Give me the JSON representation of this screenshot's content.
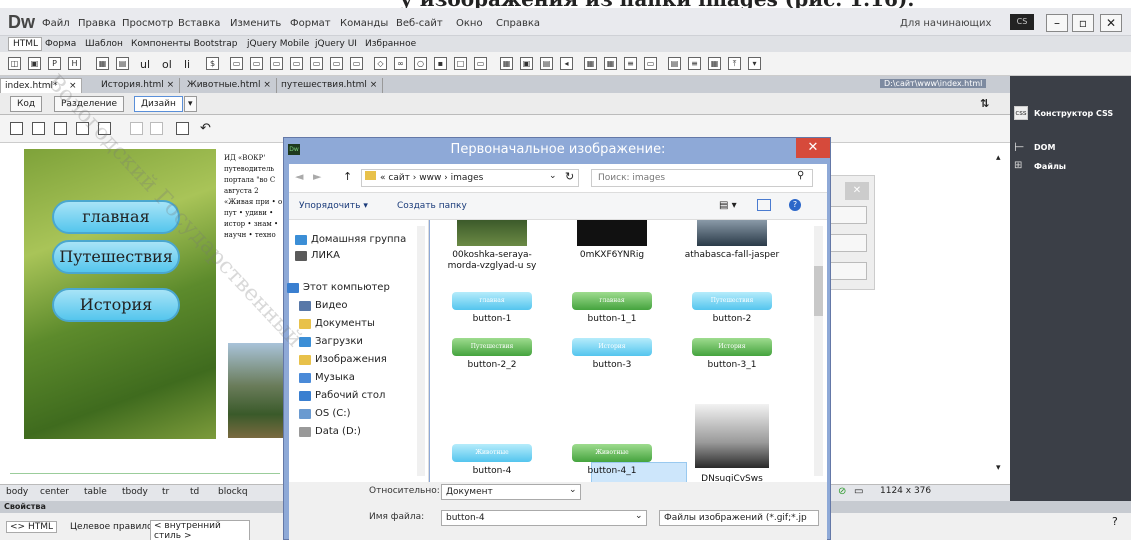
{
  "app": {
    "logo": "Dw",
    "workspace": "Для начинающих",
    "cs_badge": "CS"
  },
  "menu": [
    "Файл",
    "Правка",
    "Просмотр",
    "Вставка",
    "Изменить",
    "Формат",
    "Команды",
    "Веб-сайт",
    "Окно",
    "Справка"
  ],
  "insert_tabs": [
    "HTML",
    "Форма",
    "Шаблон",
    "Компоненты Bootstrap",
    "jQuery Mobile",
    "jQuery UI",
    "Избранное"
  ],
  "doc_tabs": [
    "index.html*",
    "История.html",
    "Животные.html",
    "путешествия.html"
  ],
  "doc_path": "D:\\сайт\\www\\index.html",
  "view_buttons": [
    "Код",
    "Разделение",
    "Дизайн"
  ],
  "nav_buttons": [
    "главная",
    "Путешествия",
    "История"
  ],
  "doc_text": "ИД «ВОКР' путеводитель портала \"во С августа 2 «Живая при • о пут • удиви • истор • знам • научн • техно",
  "tag_selector": [
    "body",
    "center",
    "table",
    "tbody",
    "tr",
    "td",
    "blockq"
  ],
  "status_right": "1124 x 376",
  "properties": {
    "title": "Свойства",
    "html": "<> HTML",
    "rule_label": "Целевое правило",
    "rule_value": "< внутренний стиль >"
  },
  "right_panel": [
    "Конструктор CSS",
    "DOM",
    "Файлы"
  ],
  "dialog": {
    "title": "Первоначальное изображение:",
    "breadcrumb": "« сайт › www › images",
    "search": "Поиск: images",
    "organize": "Упорядочить",
    "new_folder": "Создать папку",
    "nav": [
      "Домашняя группа",
      "ЛИКА",
      "Этот компьютер",
      "Видео",
      "Документы",
      "Загрузки",
      "Изображения",
      "Музыка",
      "Рабочий стол",
      "OS (C:)",
      "Data (D:)"
    ],
    "files": [
      {
        "name": "00koshka-seraya-morda-vzglyad-u sy",
        "thumb": ""
      },
      {
        "name": "0mKXF6YNRig",
        "thumb": ""
      },
      {
        "name": "athabasca-fall-jasper",
        "thumb": ""
      },
      {
        "name": "button-1",
        "thumb": "главная"
      },
      {
        "name": "button-1_1",
        "thumb": "главная"
      },
      {
        "name": "button-2",
        "thumb": "Путешествия"
      },
      {
        "name": "button-2_2",
        "thumb": "Путешествия"
      },
      {
        "name": "button-3",
        "thumb": "История"
      },
      {
        "name": "button-3_1",
        "thumb": "История"
      },
      {
        "name": "button-4",
        "thumb": "Животные"
      },
      {
        "name": "button-4_1",
        "thumb": "Животные"
      },
      {
        "name": "DNsugiCvSws",
        "thumb": ""
      }
    ],
    "relative_label": "Относительно:",
    "relative_value": "Документ",
    "filename_label": "Имя файла:",
    "filename_value": "button-4",
    "filter": "Файлы изображений (*.gif;*.jp"
  },
  "colors": {
    "dialog_frame": "#8ea9d7",
    "selection": "#cde6fb",
    "blue_button": "#55c6ed",
    "green_button": "#45a33e",
    "close": "#d64a3b"
  }
}
